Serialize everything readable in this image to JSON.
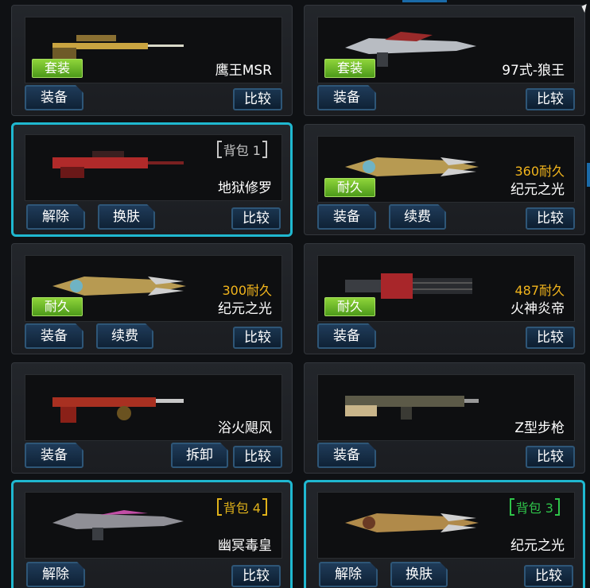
{
  "cards": [
    {
      "name": "鹰王MSR",
      "badge": "套装",
      "buttons": [
        "装备"
      ],
      "compare": "比较",
      "gun_icon": "sniper-rifle-icon",
      "gun_color": "#c9a441"
    },
    {
      "name": "97式-狼王",
      "badge": "套装",
      "buttons": [
        "装备"
      ],
      "compare": "比较",
      "gun_icon": "assault-rifle-icon",
      "gun_color": "#b8bcc2"
    },
    {
      "name": "地狱修罗",
      "bag": "背包 1",
      "bag_color": "gray",
      "buttons": [
        "解除",
        "换肤"
      ],
      "compare": "比较",
      "selected": true,
      "gun_icon": "sniper-rifle-icon",
      "gun_color": "#b02a2a"
    },
    {
      "name": "纪元之光",
      "durability": "360耐久",
      "badge": "耐久",
      "buttons": [
        "装备",
        "续费"
      ],
      "compare": "比较",
      "gun_icon": "energy-gun-icon",
      "gun_color": "#b79a52"
    },
    {
      "name": "纪元之光",
      "durability": "300耐久",
      "badge": "耐久",
      "buttons": [
        "装备",
        "续费"
      ],
      "compare": "比较",
      "gun_icon": "energy-gun-icon",
      "gun_color": "#b79a52"
    },
    {
      "name": "火神炎帝",
      "durability": "487耐久",
      "badge": "耐久",
      "buttons": [
        "装备"
      ],
      "compare": "比较",
      "gun_icon": "gatling-gun-icon",
      "gun_color": "#a8262a"
    },
    {
      "name": "浴火飓风",
      "buttons": [
        "装备",
        "拆卸"
      ],
      "third_button": true,
      "compare": "比较",
      "gun_icon": "machine-gun-icon",
      "gun_color": "#a83021"
    },
    {
      "name": "Z型步枪",
      "buttons": [
        "装备"
      ],
      "compare": "比较",
      "gun_icon": "rifle-icon",
      "gun_color": "#7d7a5c"
    },
    {
      "name": "幽冥毒皇",
      "bag": "背包 4",
      "bag_color": "yellow",
      "buttons": [
        "解除"
      ],
      "compare": "比较",
      "selected": true,
      "gun_icon": "assault-rifle-icon",
      "gun_color": "#8f8f96"
    },
    {
      "name": "纪元之光",
      "bag": "背包 3",
      "bag_color": "green",
      "buttons": [
        "解除",
        "换肤"
      ],
      "compare": "比较",
      "selected": true,
      "gun_icon": "energy-gun-icon",
      "gun_color": "#b08a4a"
    }
  ]
}
